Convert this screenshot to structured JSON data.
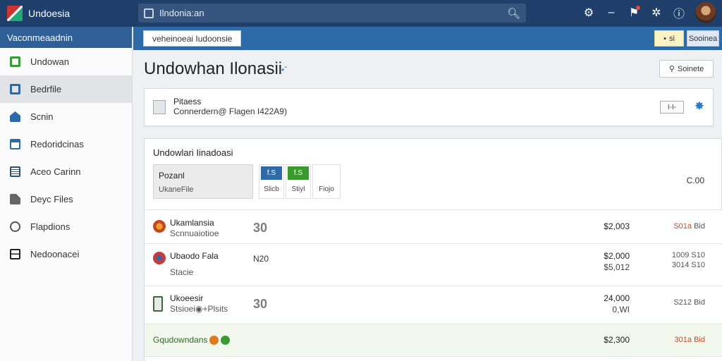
{
  "app": {
    "title": "Undoesia"
  },
  "search": {
    "placeholder": "Ilndonia:an"
  },
  "sidebar": {
    "header": "Vaconmeaadnin",
    "items": [
      {
        "label": "Undowan",
        "color": "#3a9a3a"
      },
      {
        "label": "Bedrfile",
        "color": "#2f6aa8"
      },
      {
        "label": "Scnin",
        "color": "#2f6aa8"
      },
      {
        "label": "Redoridcinas",
        "color": "#2f6aa8"
      },
      {
        "label": "Aceo Carinn",
        "color": "#2f4f6e"
      },
      {
        "label": "Deyc Files",
        "color": "#555555"
      },
      {
        "label": "Flapdions",
        "color": "#555555"
      },
      {
        "label": "Nedoonacei",
        "color": "#222222"
      }
    ]
  },
  "subbar": {
    "breadcrumb": "veheinoeai Iudoonsie",
    "yellow_button": "si",
    "light_button": "Sooinea"
  },
  "main": {
    "title": "Undowhan Ilonasii",
    "search_button": "Soinete",
    "card": {
      "line1": "Pitaess",
      "line2": "Connerdern@ Flagen I422A9)",
      "mini_button": "I-I-"
    },
    "section": {
      "title": "Undowlari Iinadoasi",
      "box_title": "Pozanl",
      "box_sub": "UkaneFile",
      "tiles": [
        {
          "chip": "f.S",
          "label": "Slicb",
          "color": "#2f6aa8"
        },
        {
          "chip": "f.S",
          "label": "Stiyl",
          "color": "#3a9a2e"
        },
        {
          "chip": "",
          "label": "Fiojo",
          "color": ""
        }
      ],
      "right_value": "C.00"
    },
    "rows": [
      {
        "name": "Ukamlansia",
        "sub": "Scnnuaiotioe",
        "mid": "30",
        "amount": "$2,003",
        "amount2": "",
        "pct": "S01a",
        "pct_b": "Bid",
        "pct2": "",
        "icon_color": "#c4481f"
      },
      {
        "name": "Ubaodo Fala",
        "sub": "Stacie",
        "mid": "N20",
        "amount": "$2,000",
        "amount2": "$5,012",
        "pct": "1009",
        "pct_b": "S10",
        "pct2": "3014 S10",
        "icon_color": "#c93a3a"
      },
      {
        "name": "Ukoeesir",
        "sub": "Stsioei◉+Plsits",
        "mid": "30",
        "amount": "24,000",
        "amount2": "0,WI",
        "pct": "S212",
        "pct_b": "Bid",
        "pct2": "",
        "icon_color": "#3a6a3a"
      }
    ],
    "group": {
      "title": "Gqudowndans",
      "amount": "$2,300",
      "pct": "301a",
      "pct_b": "Bid"
    }
  }
}
